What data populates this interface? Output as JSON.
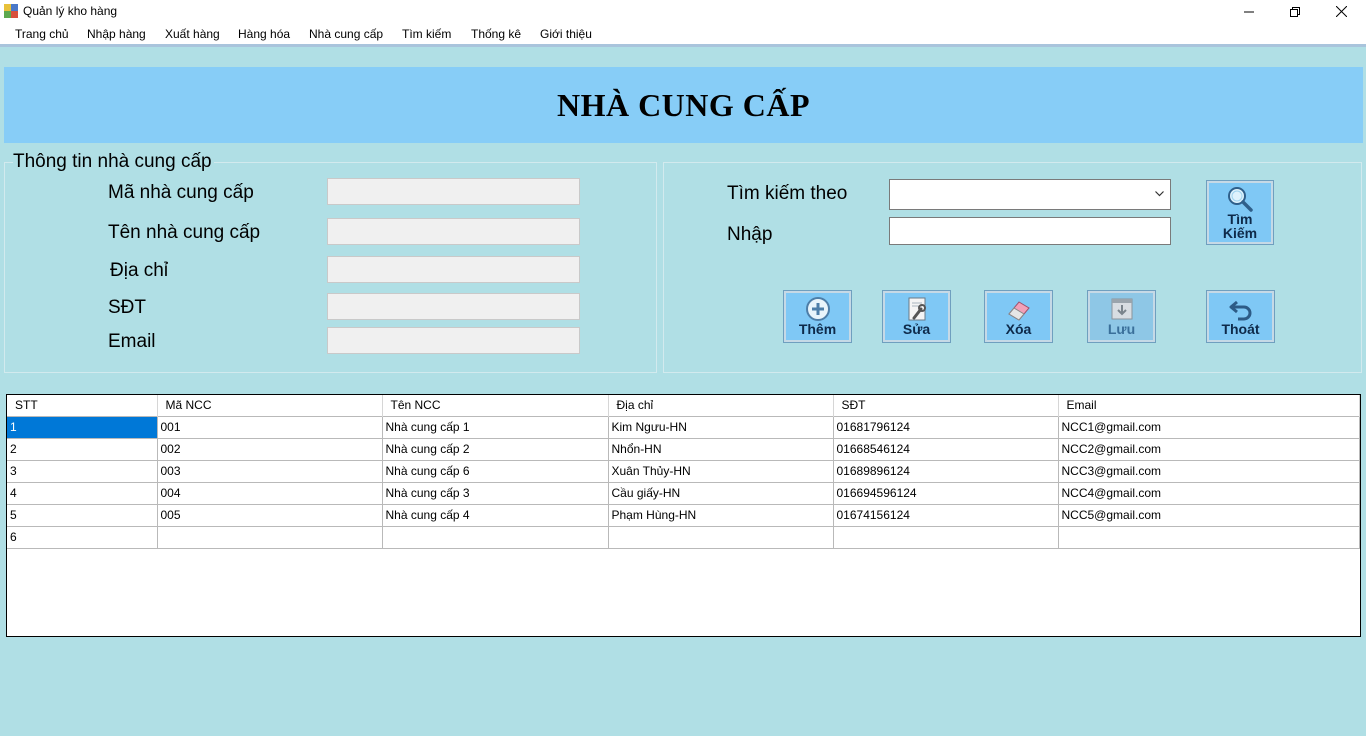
{
  "window": {
    "title": "Quản lý kho hàng",
    "controls": {
      "minimize": "—",
      "maximize": "❐",
      "close": "✕"
    }
  },
  "menu": [
    "Trang chủ",
    "Nhập hàng",
    "Xuất hàng",
    "Hàng hóa",
    "Nhà cung cấp",
    "Tìm kiếm",
    "Thống kê",
    "Giới thiệu"
  ],
  "header": {
    "title": "NHÀ CUNG CẤP"
  },
  "info": {
    "group_title": "Thông tin nhà cung cấp",
    "fields": [
      {
        "label": "Mã nhà cung cấp",
        "value": ""
      },
      {
        "label": "Tên nhà cung cấp",
        "value": ""
      },
      {
        "label": "Địa chỉ",
        "value": ""
      },
      {
        "label": "SĐT",
        "value": ""
      },
      {
        "label": "Email",
        "value": ""
      }
    ]
  },
  "search": {
    "by_label": "Tìm kiếm theo",
    "by_value": "",
    "input_label": "Nhập",
    "input_value": "",
    "button_line1": "Tìm",
    "button_line2": "Kiếm"
  },
  "actions": {
    "add": "Thêm",
    "edit": "Sửa",
    "delete": "Xóa",
    "save": "Lưu",
    "exit": "Thoát"
  },
  "grid": {
    "columns": [
      "STT",
      "Mã NCC",
      "Tên NCC",
      "Địa chỉ",
      "SĐT",
      "Email"
    ],
    "rows": [
      [
        "1",
        "001",
        "Nhà cung cấp 1",
        "Kim Ngưu-HN",
        "01681796124",
        "NCC1@gmail.com"
      ],
      [
        "2",
        "002",
        "Nhà cung cấp 2",
        "Nhổn-HN",
        "01668546124",
        "NCC2@gmail.com"
      ],
      [
        "3",
        "003",
        "Nhà cung cấp 6",
        "Xuân Thủy-HN",
        "01689896124",
        "NCC3@gmail.com"
      ],
      [
        "4",
        "004",
        "Nhà cung cấp 3",
        "Cầu giấy-HN",
        "016694596124",
        "NCC4@gmail.com"
      ],
      [
        "5",
        "005",
        "Nhà cung cấp 4",
        "Phạm Hùng-HN",
        "01674156124",
        "NCC5@gmail.com"
      ],
      [
        "6",
        "",
        "",
        "",
        "",
        ""
      ]
    ]
  },
  "colors": {
    "background": "#b0dfe5",
    "banner": "#87cdf7",
    "button": "#7fc8f5",
    "selection": "#0078d7"
  },
  "icons": {
    "add": "plus-circle-icon",
    "edit": "wrench-document-icon",
    "delete": "eraser-icon",
    "save": "download-icon",
    "exit": "undo-arrow-icon",
    "search": "magnifier-icon"
  }
}
